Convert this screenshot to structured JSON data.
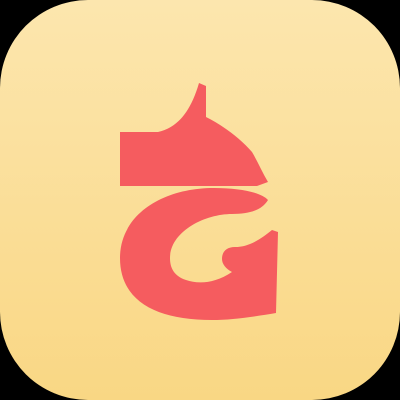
{
  "app_icon": {
    "icon": "tinyzen-logo-icon",
    "colors": {
      "page_background": "#000000",
      "tile_gradient_top": "#FCE6AE",
      "tile_gradient_bottom": "#F9D784",
      "glyph": "#F55C5F"
    }
  }
}
